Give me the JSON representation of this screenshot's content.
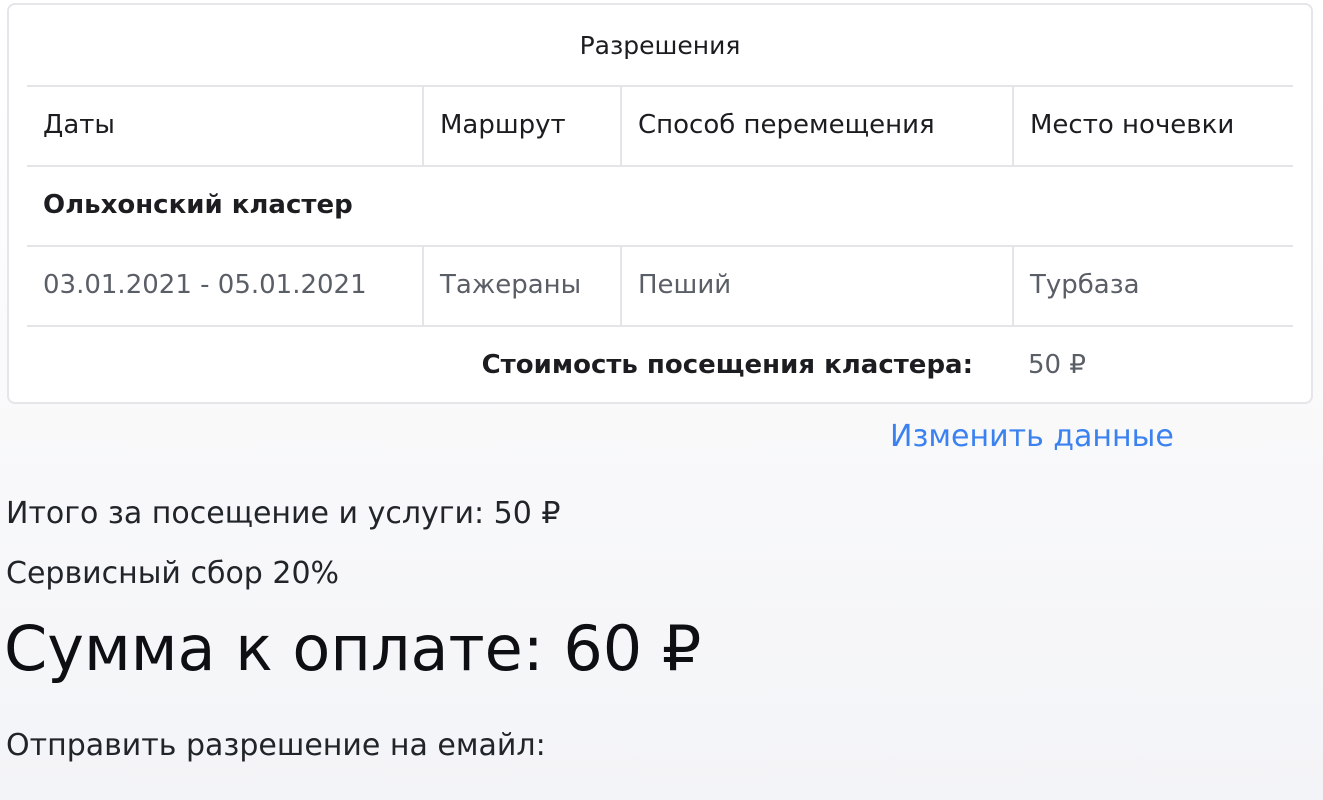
{
  "permissions": {
    "title": "Разрешения",
    "columns": [
      "Даты",
      "Маршрут",
      "Способ перемещения",
      "Место ночевки"
    ],
    "cluster": {
      "name": "Ольхонский кластер",
      "rows": [
        {
          "dates": "03.01.2021 - 05.01.2021",
          "route": "Тажераны",
          "transport": "Пеший",
          "lodging": "Турбаза"
        }
      ],
      "cost_label": "Стоимость посещения кластера:",
      "cost_value": "50 ₽"
    }
  },
  "actions": {
    "edit_label": "Изменить данные"
  },
  "summary": {
    "total_label": "Итого за посещение и услуги: 50 ₽",
    "fee_label": "Сервисный сбор 20%",
    "pay_label": "Сумма к оплате: 60 ₽",
    "email_label": "Отправить разрешение на емайл:"
  }
}
